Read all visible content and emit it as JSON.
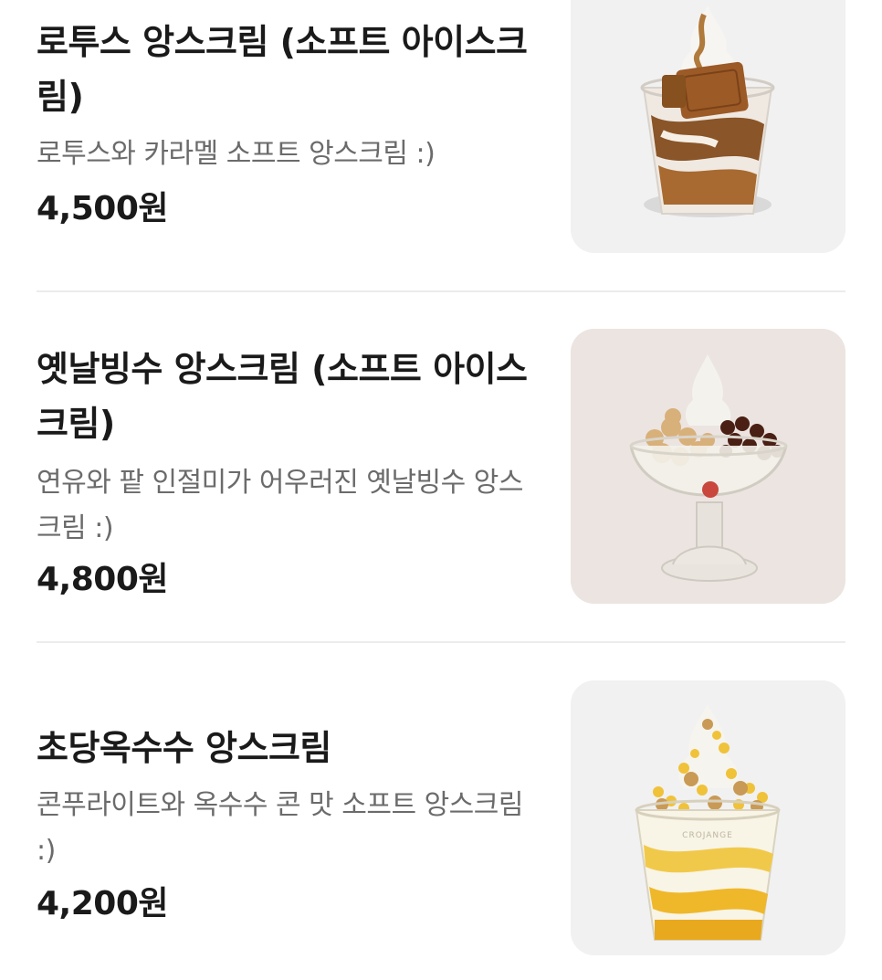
{
  "menu": {
    "items": [
      {
        "title": "로투스 앙스크림 (소프트 아이스크림)",
        "description": "로투스와 카라멜 소프트 앙스크림 :)",
        "price": "4,500원",
        "image_icon": "lotus-sundae-image"
      },
      {
        "title": "옛날빙수 앙스크림 (소프트 아이스크림)",
        "description": "연유와 팥 인절미가 어우러진 옛날빙수 앙스크림 :)",
        "price": "4,800원",
        "image_icon": "bingsu-sundae-image"
      },
      {
        "title": "초당옥수수 앙스크림",
        "description": "콘푸라이트와 옥수수 콘 맛 소프트 앙스크림 :)",
        "price": "4,200원",
        "image_icon": "corn-sundae-image",
        "cup_text": "CROJANGE"
      }
    ]
  },
  "colors": {
    "thumb_bg_light": "#f1f1f1",
    "thumb_bg_warm": "#ece4e0",
    "divider": "#ececec",
    "title": "#1a1a1a",
    "description": "#6b6b6b"
  }
}
